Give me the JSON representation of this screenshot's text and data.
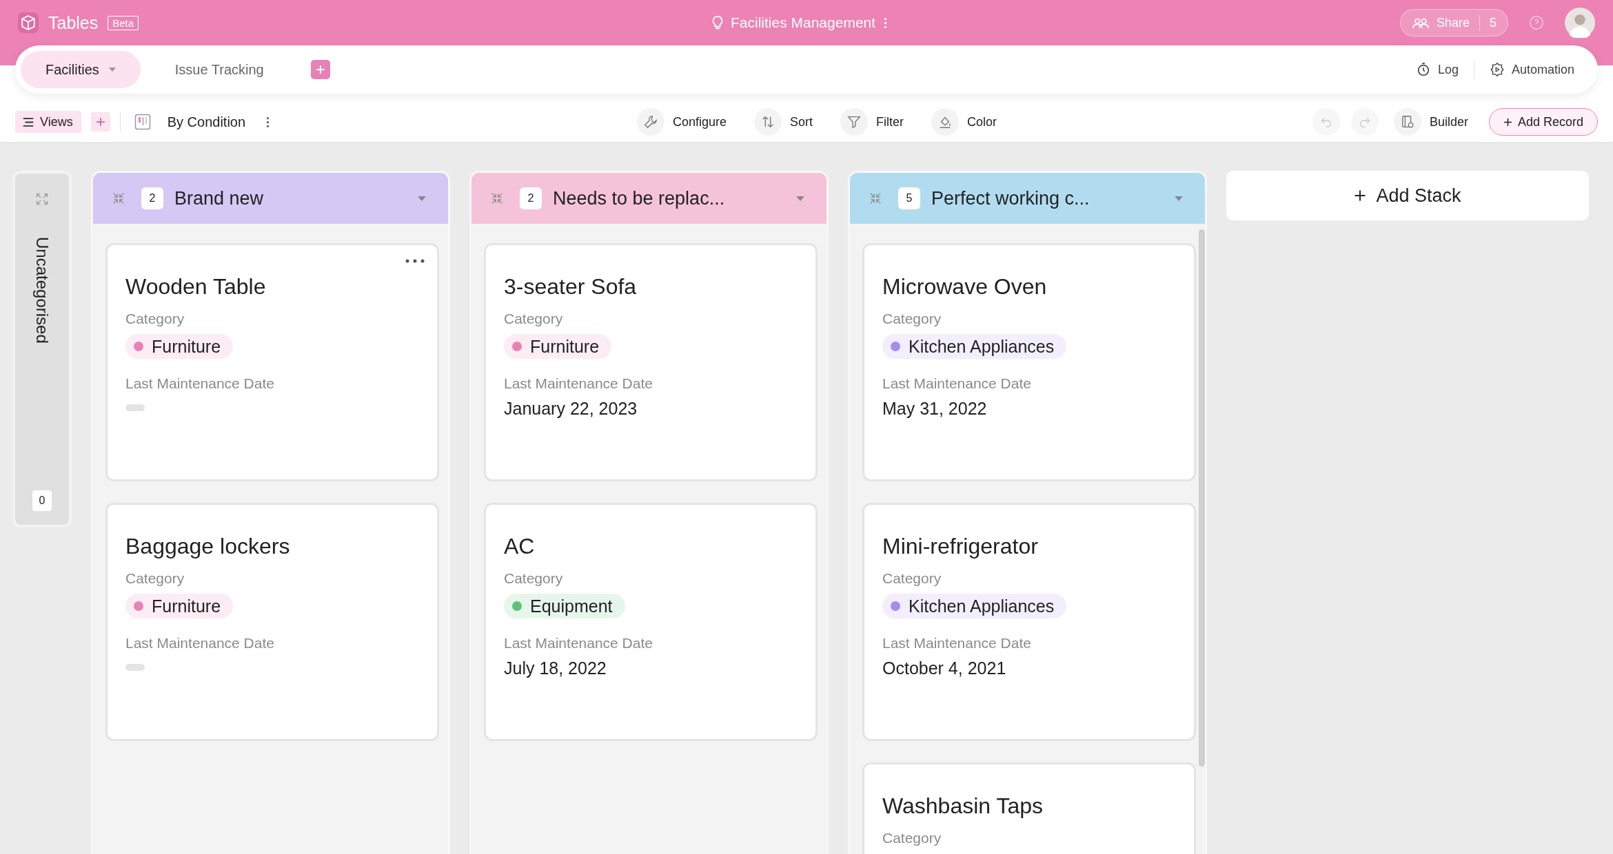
{
  "app": {
    "name": "Tables",
    "badge": "Beta"
  },
  "base": {
    "title": "Facilities Management"
  },
  "share": {
    "label": "Share",
    "count": "5"
  },
  "tabs": [
    {
      "label": "Facilities",
      "selected": true
    },
    {
      "label": "Issue Tracking",
      "selected": false
    }
  ],
  "tab_actions": [
    {
      "label": "Log",
      "kind": "log"
    },
    {
      "label": "Automation",
      "kind": "automation"
    }
  ],
  "toolbar": {
    "views": "Views",
    "view_name": "By Condition",
    "tools": [
      {
        "label": "Configure",
        "kind": "configure"
      },
      {
        "label": "Sort",
        "kind": "sort"
      },
      {
        "label": "Filter",
        "kind": "filter"
      },
      {
        "label": "Color",
        "kind": "color"
      }
    ],
    "builder": "Builder",
    "add_record": "Add Record"
  },
  "uncategorised": {
    "title": "Uncategorised",
    "count": "0"
  },
  "stacks": [
    {
      "title": "Brand new",
      "count": "2",
      "color": "#d5c8f5",
      "cards": [
        {
          "title": "Wooden Table",
          "menu": true,
          "fields": [
            {
              "label": "Category",
              "kind": "tag",
              "value": "Furniture",
              "color": "#e882b6"
            },
            {
              "label": "Last Maintenance Date",
              "kind": "empty"
            }
          ]
        },
        {
          "title": "Baggage lockers",
          "menu": false,
          "fields": [
            {
              "label": "Category",
              "kind": "tag",
              "value": "Furniture",
              "color": "#e882b6"
            },
            {
              "label": "Last Maintenance Date",
              "kind": "empty"
            }
          ]
        }
      ]
    },
    {
      "title": "Needs to be replac...",
      "count": "2",
      "color": "#f5c3d9",
      "cards": [
        {
          "title": "3-seater Sofa",
          "menu": false,
          "fields": [
            {
              "label": "Category",
              "kind": "tag",
              "value": "Furniture",
              "color": "#e882b6"
            },
            {
              "label": "Last Maintenance Date",
              "kind": "text",
              "value": "January 22, 2023"
            }
          ]
        },
        {
          "title": "AC",
          "menu": false,
          "fields": [
            {
              "label": "Category",
              "kind": "tag",
              "value": "Equipment",
              "color": "#5ec27a"
            },
            {
              "label": "Last Maintenance Date",
              "kind": "text",
              "value": "July 18, 2022"
            }
          ]
        }
      ]
    },
    {
      "title": "Perfect working c...",
      "count": "5",
      "color": "#b1dcef",
      "cards": [
        {
          "title": "Microwave Oven",
          "menu": false,
          "fields": [
            {
              "label": "Category",
              "kind": "tag",
              "value": "Kitchen Appliances",
              "color": "#a78bec"
            },
            {
              "label": "Last Maintenance Date",
              "kind": "text",
              "value": "May 31, 2022"
            }
          ]
        },
        {
          "title": "Mini-refrigerator",
          "menu": false,
          "fields": [
            {
              "label": "Category",
              "kind": "tag",
              "value": "Kitchen Appliances",
              "color": "#a78bec"
            },
            {
              "label": "Last Maintenance Date",
              "kind": "text",
              "value": "October 4, 2021"
            }
          ]
        },
        {
          "title": "Washbasin Taps",
          "menu": false,
          "fields": [
            {
              "label": "Category",
              "kind": "label"
            }
          ]
        }
      ]
    }
  ],
  "add_stack": "Add Stack"
}
